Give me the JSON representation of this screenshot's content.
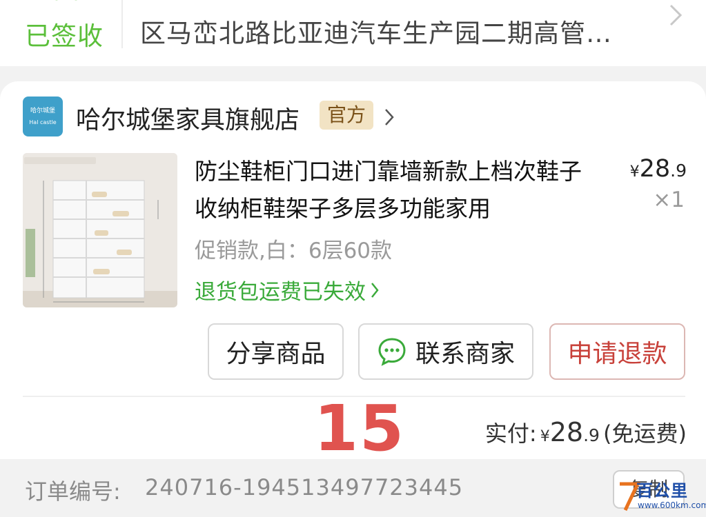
{
  "delivery": {
    "status": "已签收",
    "address": "区马峦北路比亚迪汽车生产园二期高管…"
  },
  "store": {
    "logo_text_cn": "哈尔城堡",
    "logo_text_en": "Hal castle",
    "name": "哈尔城堡家具旗舰店",
    "badge": "官方"
  },
  "product": {
    "image_label": "shoe-cabinet-product-photo",
    "title": "防尘鞋柜门口进门靠墙新款上档次鞋子收纳柜鞋架子多层多功能家用",
    "price_currency": "¥",
    "price_int": "28",
    "price_dec": ".9",
    "quantity": "×1",
    "spec": "促销款,白：6层60款",
    "return_notice": "退货包运费已失效"
  },
  "actions": {
    "share": "分享商品",
    "contact": "联系商家",
    "refund": "申请退款"
  },
  "overlay_number": "15",
  "payment": {
    "label": "实付:",
    "currency": "¥",
    "amount_int": "28",
    "amount_dec": ".9",
    "note": "(免运费)"
  },
  "order": {
    "label": "订单编号:",
    "number": "240716-194513497723445",
    "copy_label": "复制"
  },
  "watermark": {
    "text": "百公里",
    "url": "www.600km.com"
  },
  "colors": {
    "status_green": "#5bbf3a",
    "refund_red": "#c8413a",
    "overlay_red": "#e0534f",
    "badge_bg": "#f2e3c4"
  }
}
